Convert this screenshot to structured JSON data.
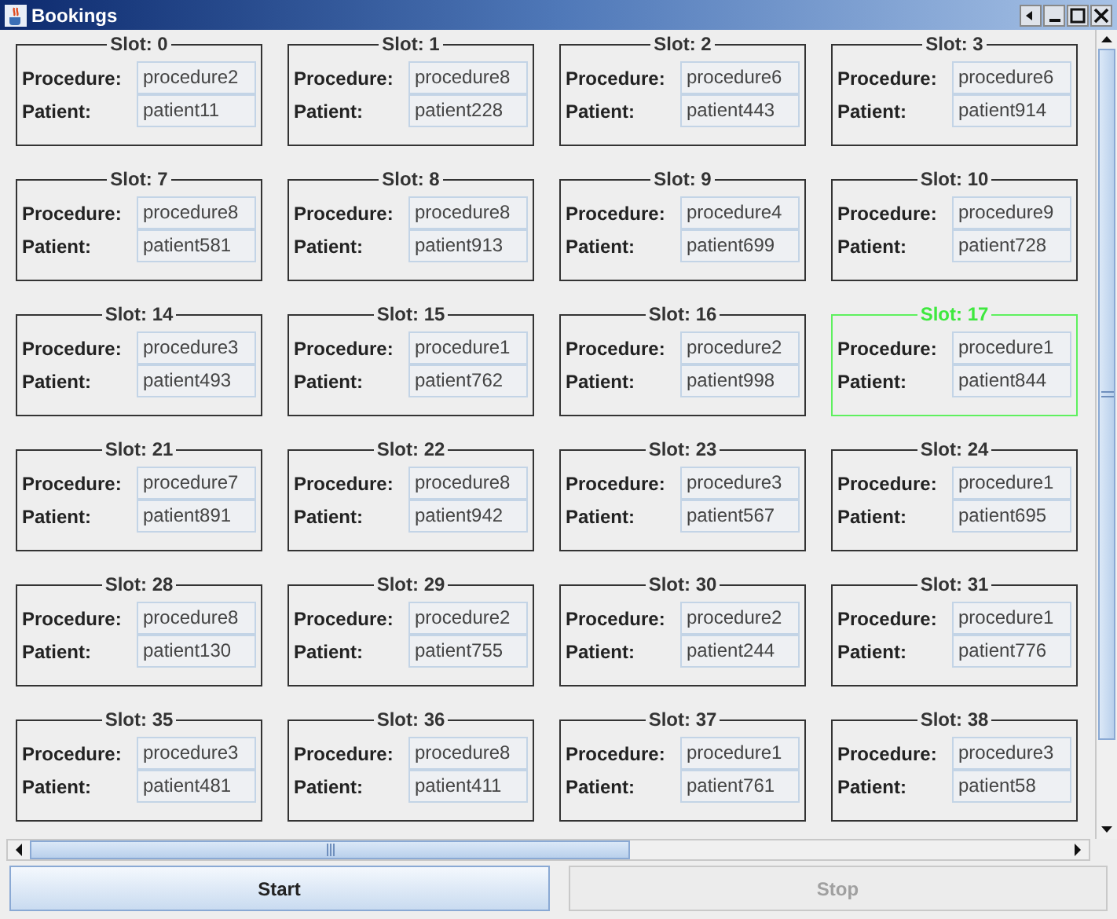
{
  "window": {
    "title": "Bookings"
  },
  "slots": [
    {
      "title": "Slot: 0",
      "procedure_label": "Procedure:",
      "procedure": "procedure2",
      "patient_label": "Patient:",
      "patient": "patient11",
      "selected": false
    },
    {
      "title": "Slot: 1",
      "procedure_label": "Procedure:",
      "procedure": "procedure8",
      "patient_label": "Patient:",
      "patient": "patient228",
      "selected": false
    },
    {
      "title": "Slot: 2",
      "procedure_label": "Procedure:",
      "procedure": "procedure6",
      "patient_label": "Patient:",
      "patient": "patient443",
      "selected": false
    },
    {
      "title": "Slot: 3",
      "procedure_label": "Procedure:",
      "procedure": "procedure6",
      "patient_label": "Patient:",
      "patient": "patient914",
      "selected": false
    },
    {
      "title": "Slot: 7",
      "procedure_label": "Procedure:",
      "procedure": "procedure8",
      "patient_label": "Patient:",
      "patient": "patient581",
      "selected": false
    },
    {
      "title": "Slot: 8",
      "procedure_label": "Procedure:",
      "procedure": "procedure8",
      "patient_label": "Patient:",
      "patient": "patient913",
      "selected": false
    },
    {
      "title": "Slot: 9",
      "procedure_label": "Procedure:",
      "procedure": "procedure4",
      "patient_label": "Patient:",
      "patient": "patient699",
      "selected": false
    },
    {
      "title": "Slot: 10",
      "procedure_label": "Procedure:",
      "procedure": "procedure9",
      "patient_label": "Patient:",
      "patient": "patient728",
      "selected": false
    },
    {
      "title": "Slot: 14",
      "procedure_label": "Procedure:",
      "procedure": "procedure3",
      "patient_label": "Patient:",
      "patient": "patient493",
      "selected": false
    },
    {
      "title": "Slot: 15",
      "procedure_label": "Procedure:",
      "procedure": "procedure1",
      "patient_label": "Patient:",
      "patient": "patient762",
      "selected": false
    },
    {
      "title": "Slot: 16",
      "procedure_label": "Procedure:",
      "procedure": "procedure2",
      "patient_label": "Patient:",
      "patient": "patient998",
      "selected": false
    },
    {
      "title": "Slot: 17",
      "procedure_label": "Procedure:",
      "procedure": "procedure1",
      "patient_label": "Patient:",
      "patient": "patient844",
      "selected": true
    },
    {
      "title": "Slot: 21",
      "procedure_label": "Procedure:",
      "procedure": "procedure7",
      "patient_label": "Patient:",
      "patient": "patient891",
      "selected": false
    },
    {
      "title": "Slot: 22",
      "procedure_label": "Procedure:",
      "procedure": "procedure8",
      "patient_label": "Patient:",
      "patient": "patient942",
      "selected": false
    },
    {
      "title": "Slot: 23",
      "procedure_label": "Procedure:",
      "procedure": "procedure3",
      "patient_label": "Patient:",
      "patient": "patient567",
      "selected": false
    },
    {
      "title": "Slot: 24",
      "procedure_label": "Procedure:",
      "procedure": "procedure1",
      "patient_label": "Patient:",
      "patient": "patient695",
      "selected": false
    },
    {
      "title": "Slot: 28",
      "procedure_label": "Procedure:",
      "procedure": "procedure8",
      "patient_label": "Patient:",
      "patient": "patient130",
      "selected": false
    },
    {
      "title": "Slot: 29",
      "procedure_label": "Procedure:",
      "procedure": "procedure2",
      "patient_label": "Patient:",
      "patient": "patient755",
      "selected": false
    },
    {
      "title": "Slot: 30",
      "procedure_label": "Procedure:",
      "procedure": "procedure2",
      "patient_label": "Patient:",
      "patient": "patient244",
      "selected": false
    },
    {
      "title": "Slot: 31",
      "procedure_label": "Procedure:",
      "procedure": "procedure1",
      "patient_label": "Patient:",
      "patient": "patient776",
      "selected": false
    },
    {
      "title": "Slot: 35",
      "procedure_label": "Procedure:",
      "procedure": "procedure3",
      "patient_label": "Patient:",
      "patient": "patient481",
      "selected": false
    },
    {
      "title": "Slot: 36",
      "procedure_label": "Procedure:",
      "procedure": "procedure8",
      "patient_label": "Patient:",
      "patient": "patient411",
      "selected": false
    },
    {
      "title": "Slot: 37",
      "procedure_label": "Procedure:",
      "procedure": "procedure1",
      "patient_label": "Patient:",
      "patient": "patient761",
      "selected": false
    },
    {
      "title": "Slot: 38",
      "procedure_label": "Procedure:",
      "procedure": "procedure3",
      "patient_label": "Patient:",
      "patient": "patient58",
      "selected": false
    }
  ],
  "buttons": [
    {
      "label": "Start",
      "disabled": false
    },
    {
      "label": "Stop",
      "disabled": true
    }
  ]
}
